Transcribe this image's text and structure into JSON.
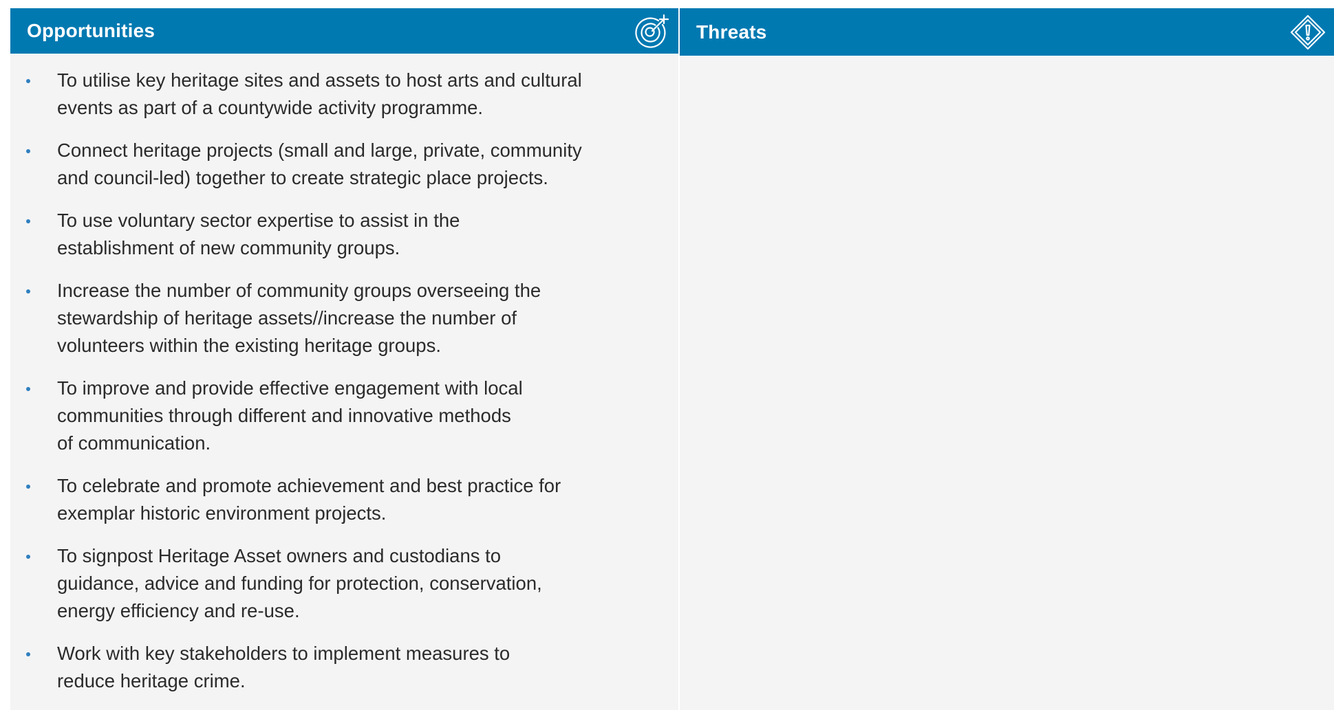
{
  "colors": {
    "header_bg": "#0079b1",
    "panel_bg": "#f4f4f5",
    "bullet": "#2f7fbf"
  },
  "opportunities": {
    "title": "Opportunities",
    "icon": "target-icon",
    "items": [
      {
        "lines": [
          "To utilise key heritage sites and assets to host arts and cultural",
          "events as part of a countywide activity programme."
        ]
      },
      {
        "lines": [
          "Connect heritage projects (small and large, private, community",
          "and council-led) together to create strategic place projects."
        ]
      },
      {
        "lines": [
          "To use voluntary sector expertise to assist in the",
          "establishment of new community groups."
        ]
      },
      {
        "lines": [
          "Increase the number of community groups overseeing the",
          "stewardship of heritage assets//increase the number of",
          "volunteers within the existing heritage groups."
        ]
      },
      {
        "lines": [
          "To improve and provide effective engagement with local",
          "communities through different and innovative methods",
          "of communication."
        ]
      },
      {
        "lines": [
          "To celebrate and promote achievement and best practice for",
          "exemplar historic environment projects."
        ]
      },
      {
        "lines": [
          "To signpost Heritage Asset owners and custodians to",
          "guidance, advice and funding for protection, conservation,",
          "energy efficiency and re-use."
        ]
      },
      {
        "lines": [
          "Work with key stakeholders to implement measures to",
          "reduce heritage crime."
        ]
      }
    ]
  },
  "threats": {
    "title": "Threats",
    "icon": "warning-diamond-icon",
    "items": []
  }
}
